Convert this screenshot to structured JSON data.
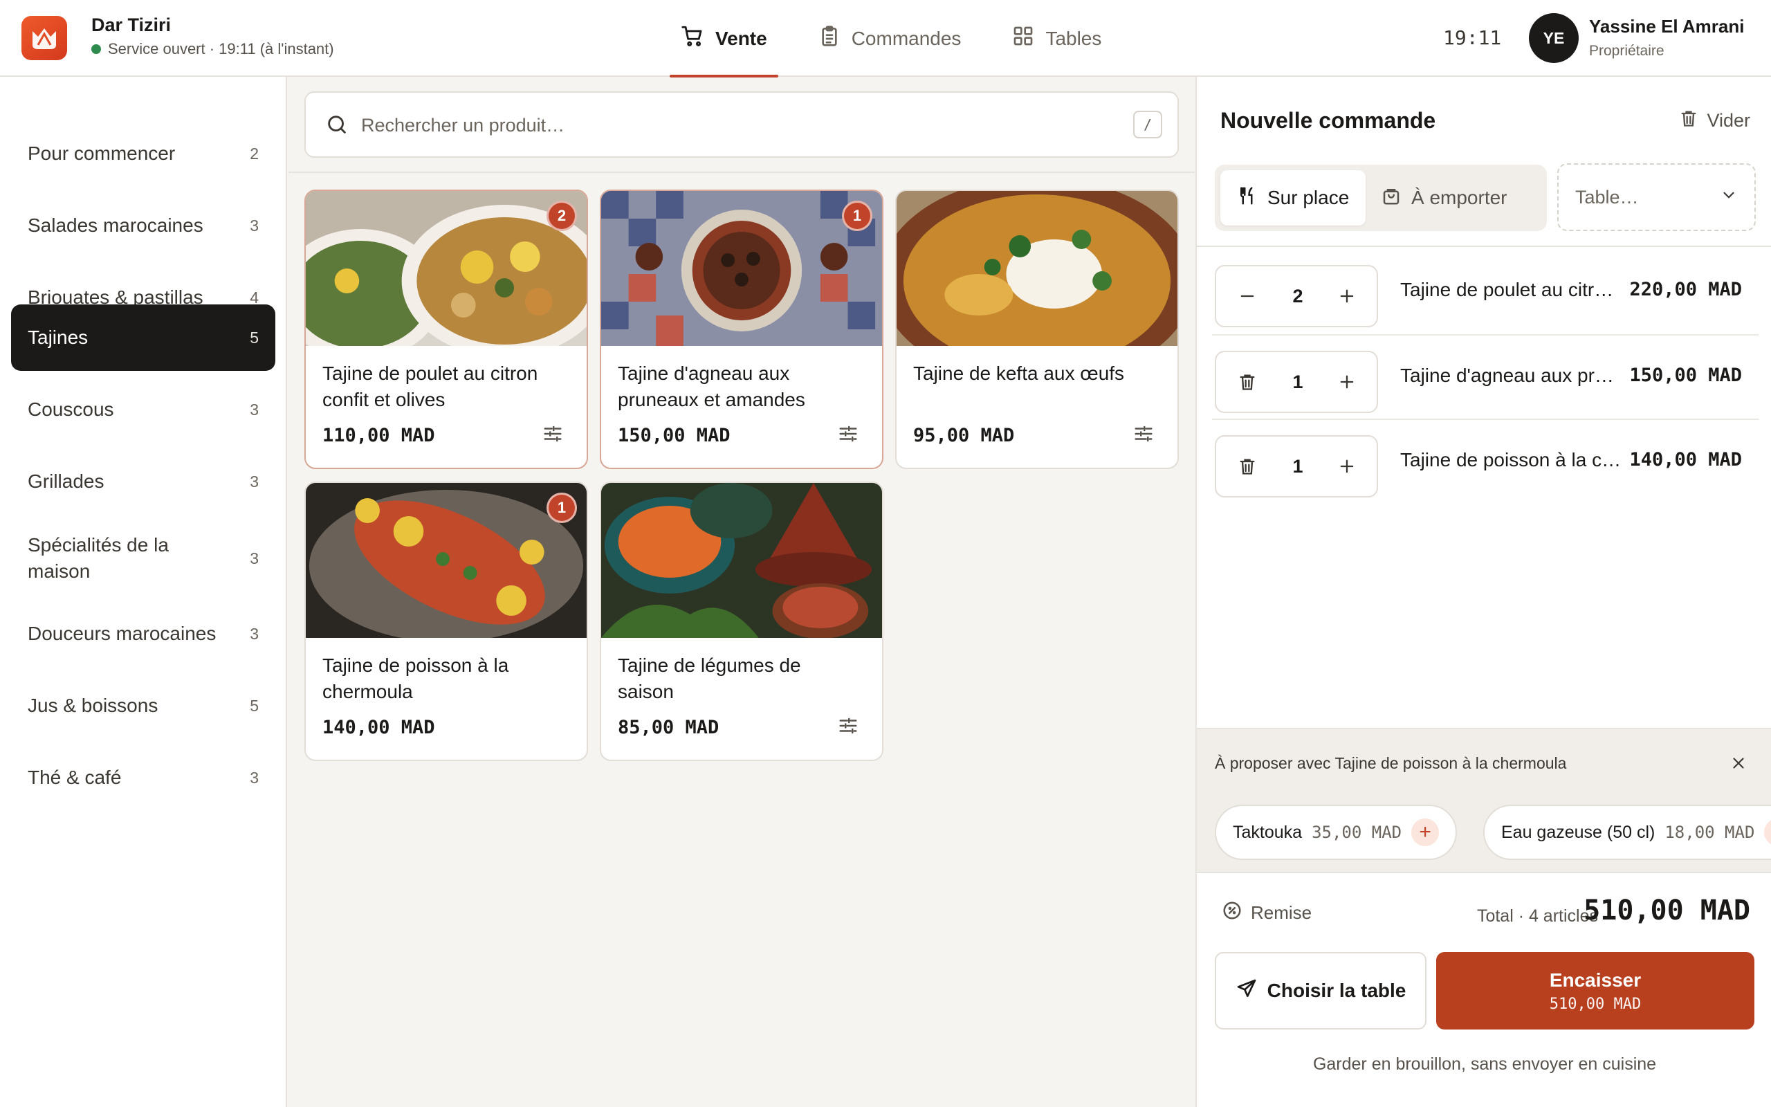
{
  "header": {
    "brand_name": "Dar Tiziri",
    "status": "Service ouvert · 19:11 (à l'instant)",
    "clock": "19:11",
    "user": {
      "initials": "YE",
      "name": "Yassine El Amrani",
      "role": "Propriétaire"
    },
    "nav": [
      {
        "label": "Vente",
        "icon": "cart-icon",
        "active": true
      },
      {
        "label": "Commandes",
        "icon": "clipboard-icon",
        "active": false
      },
      {
        "label": "Tables",
        "icon": "grid-icon",
        "active": false
      }
    ]
  },
  "categories": [
    {
      "label": "Pour commencer",
      "count": "2"
    },
    {
      "label": "Salades marocaines",
      "count": "3"
    },
    {
      "label": "Briouates & pastillas",
      "count": "4"
    },
    {
      "label": "Tajines",
      "count": "5",
      "active": true
    },
    {
      "label": "Couscous",
      "count": "3"
    },
    {
      "label": "Grillades",
      "count": "3"
    },
    {
      "label": "Spécialités de la maison",
      "count": "3"
    },
    {
      "label": "Douceurs marocaines",
      "count": "3"
    },
    {
      "label": "Jus & boissons",
      "count": "5"
    },
    {
      "label": "Thé & café",
      "count": "3"
    }
  ],
  "search": {
    "placeholder": "Rechercher un produit…",
    "shortcut": "/"
  },
  "products": [
    {
      "name": "Tajine de poulet au citron confit et olives",
      "price": "110,00 MAD",
      "badge": "2"
    },
    {
      "name": "Tajine d'agneau aux pruneaux et amandes",
      "price": "150,00 MAD",
      "badge": "1"
    },
    {
      "name": "Tajine de kefta aux œufs",
      "price": "95,00 MAD",
      "badge": ""
    },
    {
      "name": "Tajine de poisson à la chermoula",
      "price": "140,00 MAD",
      "badge": "1"
    },
    {
      "name": "Tajine de légumes de saison",
      "price": "85,00 MAD",
      "badge": ""
    }
  ],
  "order": {
    "title": "Nouvelle commande",
    "clear_label": "Vider",
    "modes": {
      "dine_in": "Sur place",
      "takeaway": "À emporter"
    },
    "table_placeholder": "Table…",
    "lines": [
      {
        "qty": "2",
        "name": "Tajine de poulet au citron confit et olives",
        "price": "220,00 MAD"
      },
      {
        "qty": "1",
        "name": "Tajine d'agneau aux pruneaux et amandes",
        "price": "150,00 MAD"
      },
      {
        "qty": "1",
        "name": "Tajine de poisson à la chermoula",
        "price": "140,00 MAD"
      }
    ],
    "suggestions": {
      "title": "À proposer avec Tajine de poisson à la chermoula",
      "items": [
        {
          "name": "Taktouka",
          "price": "35,00 MAD"
        },
        {
          "name": "Eau gazeuse (50 cl)",
          "price": "18,00 MAD"
        }
      ]
    },
    "discount_label": "Remise",
    "total_label": "Total · 4 articles",
    "total_value": "510,00 MAD",
    "choose_table_label": "Choisir la table",
    "pay_label": "Encaisser",
    "pay_amount": "510,00 MAD",
    "draft_label": "Garder en brouillon, sans envoyer en cuisine"
  },
  "colors": {
    "accent": "#c0432a",
    "pay_button": "#b8401f",
    "status_green": "#2f8a4d",
    "dark": "#1c1a18"
  }
}
